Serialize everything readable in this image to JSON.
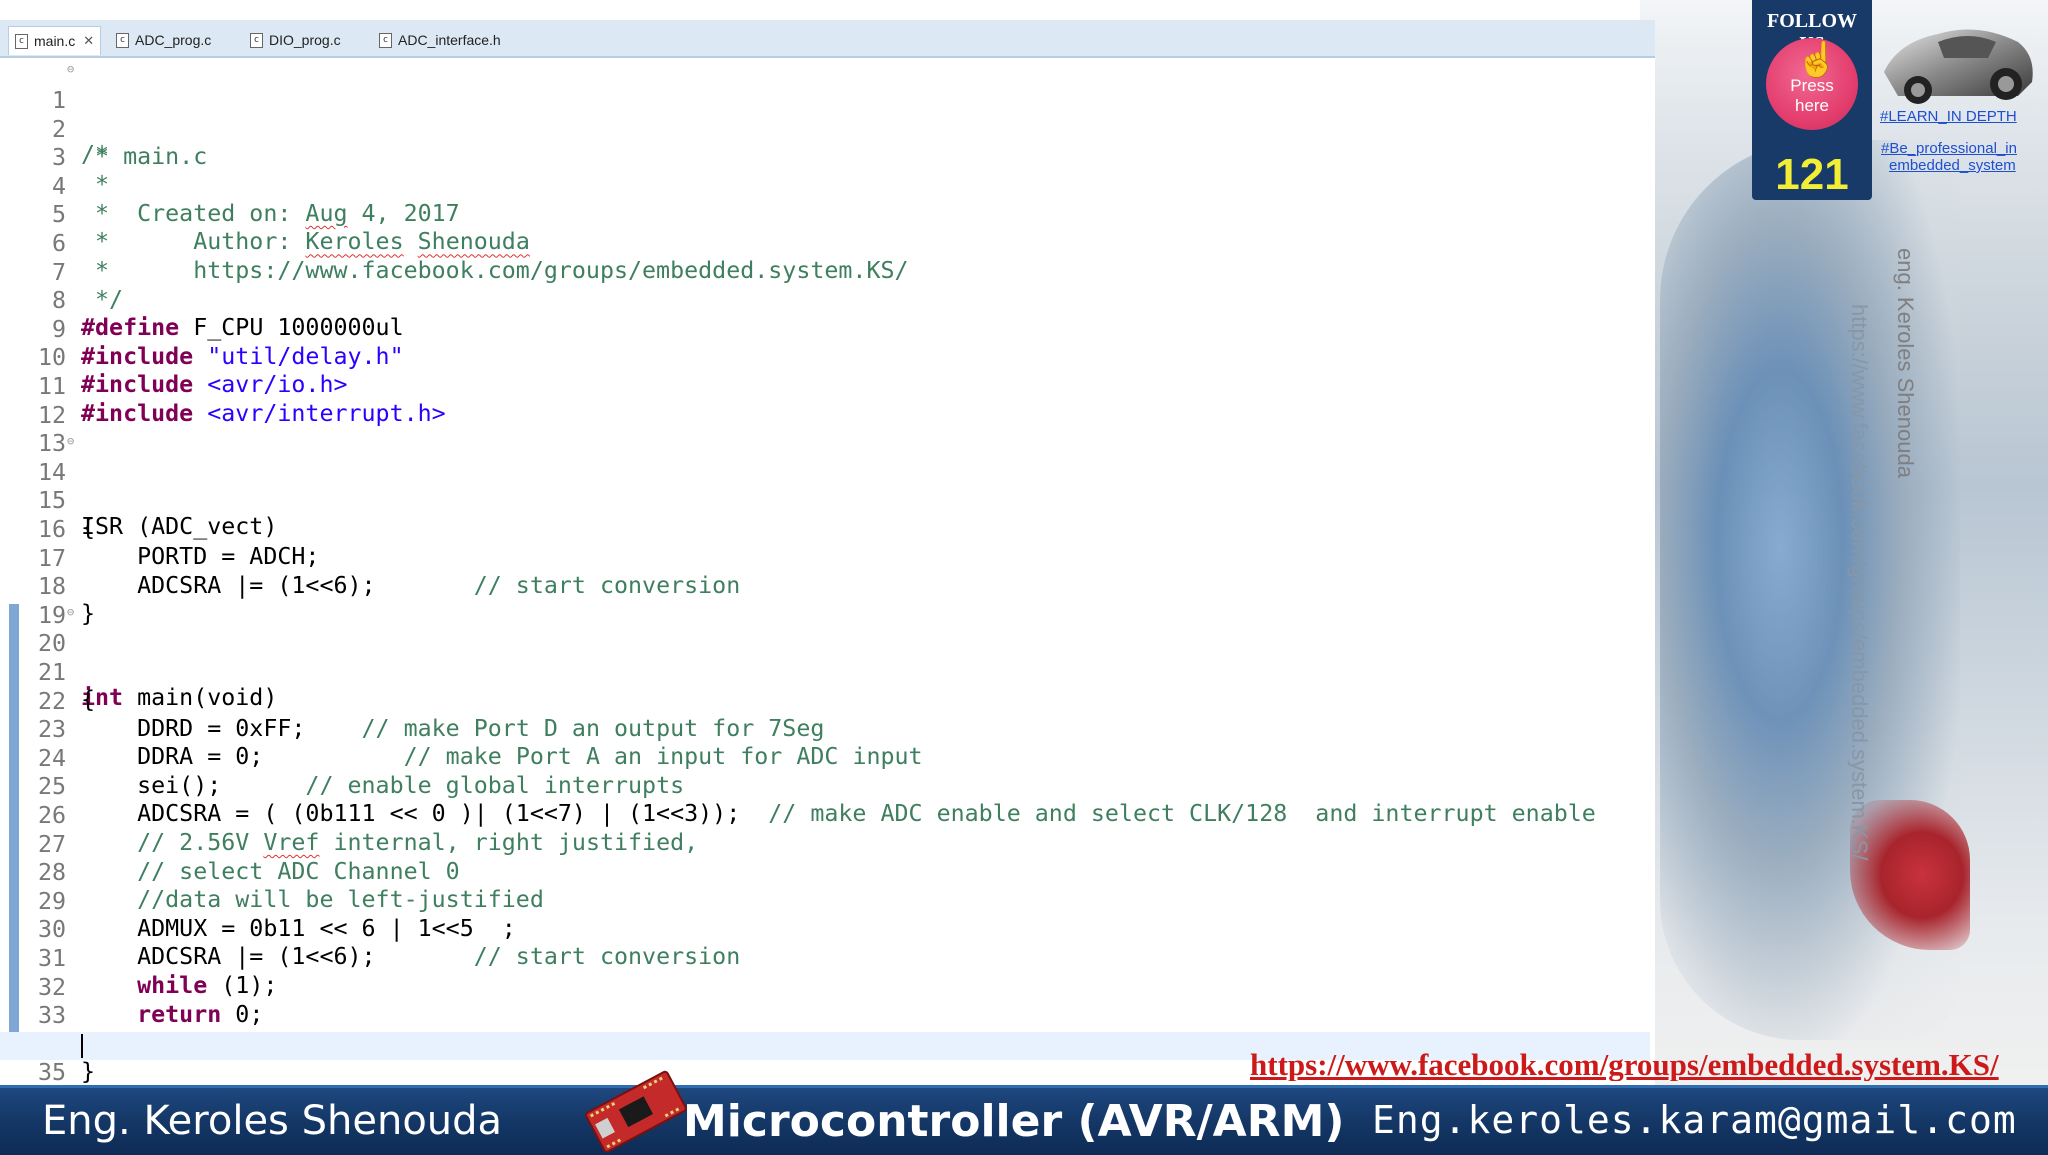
{
  "tabs": [
    {
      "label": "main.c",
      "active": true,
      "icon": "c-file-icon",
      "close": "✕"
    },
    {
      "label": "ADC_prog.c",
      "active": false,
      "icon": "c-file-icon"
    },
    {
      "label": "DIO_prog.c",
      "active": false,
      "icon": "c-file-icon"
    },
    {
      "label": "ADC_interface.h",
      "active": false,
      "icon": "c-file-icon"
    }
  ],
  "editor": {
    "line_numbers": [
      "1",
      "2",
      "3",
      "4",
      "5",
      "6",
      "7",
      "8",
      "9",
      "10",
      "11",
      "12",
      "13",
      "14",
      "15",
      "16",
      "17",
      "18",
      "19",
      "20",
      "21",
      "22",
      "23",
      "24",
      "25",
      "26",
      "27",
      "28",
      "29",
      "30",
      "31",
      "32",
      "33",
      "34",
      "35"
    ],
    "colors": {
      "comment": "#3f7f5f",
      "keyword": "#7f0055",
      "string": "#2a00ff",
      "current_line": "#e8f2fe"
    },
    "code": {
      "l1": "/*",
      "l2": " * main.c",
      "l3": " *",
      "l4_a": " *  Created on: ",
      "l4_b": "Aug",
      "l4_c": " 4, 2017",
      "l5_a": " *      Author: ",
      "l5_b": "Keroles",
      "l5_c": " ",
      "l5_d": "Shenouda",
      "l6": " *      https://www.facebook.com/groups/embedded.system.KS/",
      "l7": " */",
      "l8_kw": "#define",
      "l8_rest": " F_CPU 1000000ul",
      "l9_kw": "#include",
      "l9_str": " \"util/delay.h\"",
      "l10_kw": "#include",
      "l10_str": " <avr/io.h>",
      "l11_kw": "#include",
      "l11_str": " <avr/interrupt.h>",
      "l14": "ISR (ADC_vect)",
      "l15": "{",
      "l16": "    PORTD = ADCH;",
      "l17_code": "    ADCSRA |= (1<<6);       ",
      "l17_cm": "// start conversion",
      "l18": "}",
      "l20_kw": "int",
      "l20_rest": " main(void)",
      "l21": "{",
      "l22_code": "    DDRD = 0xFF;    ",
      "l22_cm": "// make Port D an output for 7Seg",
      "l23_code": "    DDRA = 0;          ",
      "l23_cm": "// make Port A an input for ADC input",
      "l24_code": "    sei();      ",
      "l24_cm": "// enable global interrupts",
      "l25_code": "    ADCSRA = ( (0b111 << 0 )| (1<<7) | (1<<3));  ",
      "l25_cm": "// make ADC enable and select CLK/128  and interrupt enable",
      "l26_a": "    // 2.56V ",
      "l26_b": "Vref",
      "l26_c": " internal, right justified,",
      "l27": "    // select ADC Channel 0",
      "l28": "    //data will be left-justified",
      "l29": "    ADMUX = 0b11 << 6 | 1<<5  ;",
      "l30_code": "    ADCSRA |= (1<<6);       ",
      "l30_cm": "// start conversion",
      "l31_kw": "while",
      "l31_rest": " (1);",
      "l32_kw": "return",
      "l32_rest": " 0;",
      "l34": "}"
    },
    "fold_marker": "⊖"
  },
  "follow_badge": {
    "title": "FOLLOW US",
    "press_line1": "Press",
    "press_line2": "here",
    "count": "121",
    "hand_icon": "hand-pointer-icon"
  },
  "side_links": {
    "learn": "#LEARN_IN DEPTH",
    "prof_line1": "#Be_professional_in",
    "prof_line2": "embedded_system"
  },
  "watermarks": {
    "name": "eng. Keroles Shenouda",
    "url": "https://www.facebook.com/groups/embedded.system.KS/"
  },
  "banner_url": "https://www.facebook.com/groups/embedded.system.KS/",
  "footer": {
    "left": "Eng. Keroles Shenouda",
    "center": "Microcontroller (AVR/ARM)",
    "right": "Eng.keroles.karam@gmail.com",
    "board_icon": "avr-board-icon"
  }
}
